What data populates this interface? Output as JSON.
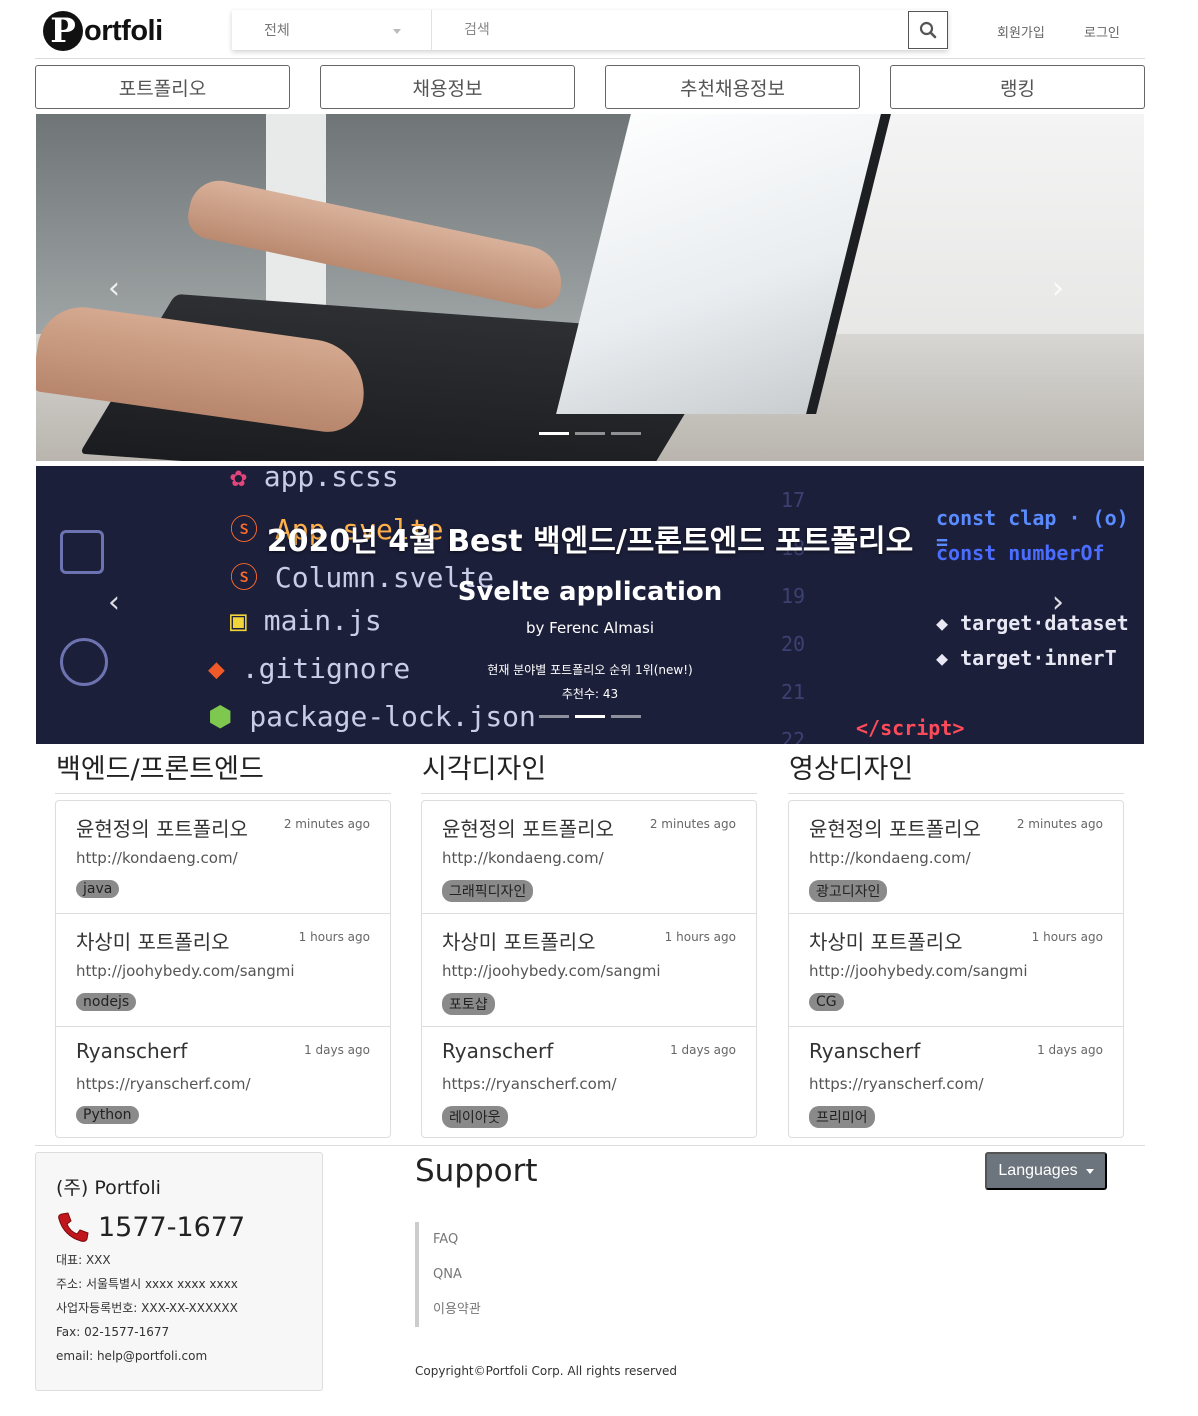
{
  "header": {
    "logo_letter": "P",
    "logo_text": "ortfoli",
    "search_category": "전체",
    "search_placeholder": "검색",
    "signup": "회원가입",
    "login": "로그인"
  },
  "nav": [
    "포트폴리오",
    "채용정보",
    "추천채용정보",
    "랭킹"
  ],
  "hero": {
    "prev": "‹",
    "next": "›",
    "indicator_count": 3,
    "active_indicator": 0
  },
  "best": {
    "file_list": [
      "app.scss",
      "App.svelte",
      "Column.svelte",
      "main.js",
      ".gitignore",
      "package-lock.json"
    ],
    "heading": "2020년 4월 Best 백엔드/프론트엔드 포트폴리오",
    "title": "Svelte application",
    "author": "by Ferenc Almasi",
    "rank": "현재 분야별 포트폴리오 순위 1위(new!)",
    "recommend": "추천수: 43",
    "active_indicator": 1
  },
  "columns": [
    {
      "title": "백엔드/프론트엔드",
      "items": [
        {
          "title": "윤현정의 포트폴리오",
          "time": "2 minutes ago",
          "url": "http://kondaeng.com/",
          "tag": "java"
        },
        {
          "title": "차상미 포트폴리오",
          "time": "1 hours ago",
          "url": "http://joohybedy.com/sangmi",
          "tag": "nodejs"
        },
        {
          "title": "Ryanscherf",
          "time": "1 days ago",
          "url": "https://ryanscherf.com/",
          "tag": "Python"
        }
      ]
    },
    {
      "title": "시각디자인",
      "items": [
        {
          "title": "윤현정의 포트폴리오",
          "time": "2 minutes ago",
          "url": "http://kondaeng.com/",
          "tag": "그래픽디자인"
        },
        {
          "title": "차상미 포트폴리오",
          "time": "1 hours ago",
          "url": "http://joohybedy.com/sangmi",
          "tag": "포토샵"
        },
        {
          "title": "Ryanscherf",
          "time": "1 days ago",
          "url": "https://ryanscherf.com/",
          "tag": "레이아웃"
        }
      ]
    },
    {
      "title": "영상디자인",
      "items": [
        {
          "title": "윤현정의 포트폴리오",
          "time": "2 minutes ago",
          "url": "http://kondaeng.com/",
          "tag": "광고디자인"
        },
        {
          "title": "차상미 포트폴리오",
          "time": "1 hours ago",
          "url": "http://joohybedy.com/sangmi",
          "tag": "CG"
        },
        {
          "title": "Ryanscherf",
          "time": "1 days ago",
          "url": "https://ryanscherf.com/",
          "tag": "프리미어"
        }
      ]
    }
  ],
  "footer": {
    "company": "(주) Portfoli",
    "phone": "1577-1677",
    "info": [
      "대표: XXX",
      "주소: 서울특별시 xxxx xxxx xxxx",
      "사업자등록번호: XXX-XX-XXXXXX",
      "Fax: 02-1577-1677",
      "email: help@portfoli.com"
    ],
    "support_title": "Support",
    "languages": "Languages",
    "links": [
      "FAQ",
      "QNA",
      "이용약관"
    ],
    "copyright": "Copyright©Portfoli Corp. All rights reserved"
  },
  "colors": {
    "tag_bg": "#8a8a8a",
    "lang_btn": "#6c757d",
    "phone_icon": "#c0161c"
  },
  "icons": [
    "search-icon",
    "phone-icon",
    "chevron-left-icon",
    "chevron-right-icon",
    "caret-down-icon"
  ]
}
